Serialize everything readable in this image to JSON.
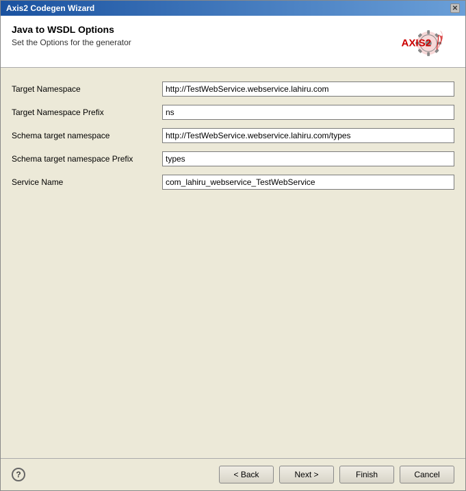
{
  "window": {
    "title": "Axis2 Codegen Wizard"
  },
  "header": {
    "heading": "Java to WSDL Options",
    "subheading": "Set the Options for the generator"
  },
  "form": {
    "fields": [
      {
        "label": "Target Namespace",
        "value": "http://TestWebService.webservice.lahiru.com",
        "name": "target-namespace"
      },
      {
        "label": "Target Namespace Prefix",
        "value": "ns",
        "name": "target-namespace-prefix"
      },
      {
        "label": "Schema target namespace",
        "value": "http://TestWebService.webservice.lahiru.com/types",
        "name": "schema-target-namespace"
      },
      {
        "label": "Schema target namespace Prefix",
        "value": "types",
        "name": "schema-target-namespace-prefix"
      },
      {
        "label": "Service Name",
        "value": "com_lahiru_webservice_TestWebService",
        "name": "service-name"
      }
    ]
  },
  "buttons": {
    "back": "< Back",
    "next": "Next >",
    "finish": "Finish",
    "cancel": "Cancel"
  },
  "icons": {
    "help": "?"
  }
}
